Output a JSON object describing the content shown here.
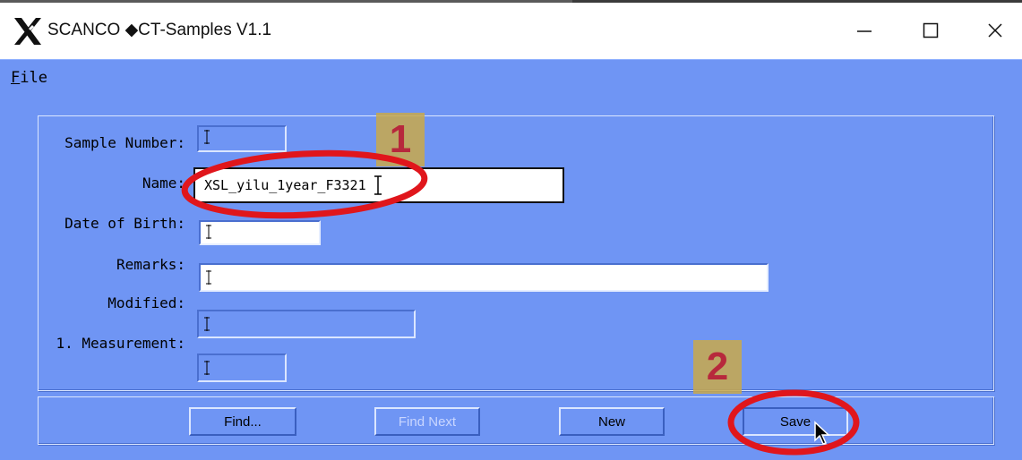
{
  "window": {
    "title": "SCANCO ◆CT-Samples V1.1",
    "controls": [
      "minimize-icon",
      "maximize-icon",
      "close-icon"
    ]
  },
  "menubar": {
    "items": [
      {
        "label_first": "F",
        "label_rest": "ile"
      }
    ]
  },
  "form": {
    "sample_number": {
      "label": "Sample Number:",
      "value": ""
    },
    "name": {
      "label": "Name:",
      "value": "XSL_yilu_1year_F3321"
    },
    "date_of_birth": {
      "label": "Date of Birth:",
      "value": ""
    },
    "remarks": {
      "label": "Remarks:",
      "value": ""
    },
    "modified": {
      "label": "Modified:",
      "value": ""
    },
    "first_measurement": {
      "label": "1. Measurement:",
      "value": ""
    }
  },
  "buttons": {
    "find": "Find...",
    "find_next": "Find Next",
    "new": "New",
    "save": "Save"
  },
  "annotations": {
    "step1": "1",
    "step2": "2"
  },
  "colors": {
    "background": "#6f95f4",
    "highlight": "#dbe6ff",
    "shadow": "#4a6fcf",
    "annotation_ring": "#e0161c",
    "badge": "#c9a94b"
  }
}
